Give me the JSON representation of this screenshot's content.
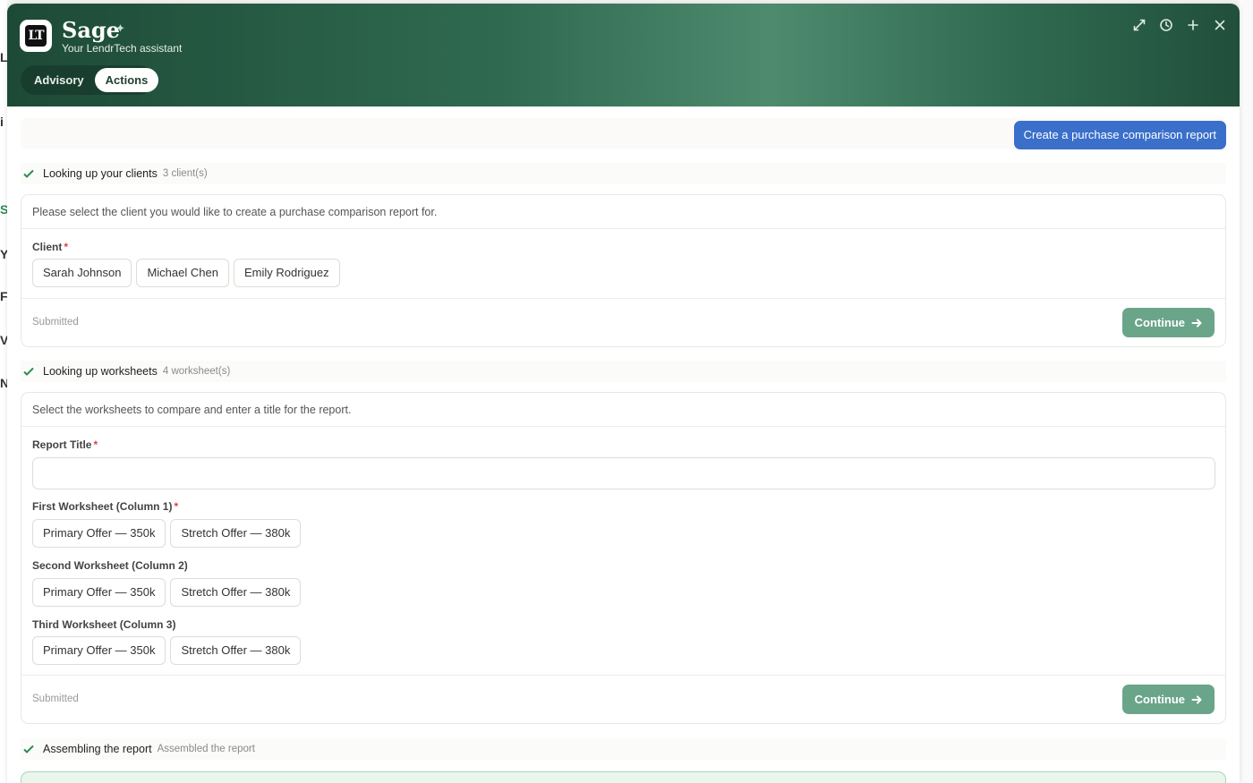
{
  "assistant": {
    "name": "Sage",
    "tagline": "Your LendrTech assistant",
    "logo_text": "LT"
  },
  "tabs": [
    {
      "label": "Advisory",
      "active": false
    },
    {
      "label": "Actions",
      "active": true
    }
  ],
  "header_icons": [
    "expand-icon",
    "history-icon",
    "plus-icon",
    "close-icon"
  ],
  "user_request": "Create a purchase comparison report",
  "steps": [
    {
      "label": "Looking up your clients",
      "detail": "3 client(s)"
    },
    {
      "label": "Looking up worksheets",
      "detail": "4 worksheet(s)"
    },
    {
      "label": "Assembling the report",
      "detail": "Assembled the report"
    }
  ],
  "client_card": {
    "prompt": "Please select the client you would like to create a purchase comparison report for.",
    "field_label": "Client",
    "options": [
      "Sarah Johnson",
      "Michael Chen",
      "Emily Rodriguez"
    ],
    "status": "Submitted",
    "continue_label": "Continue"
  },
  "worksheet_card": {
    "prompt": "Select the worksheets to compare and enter a title for the report.",
    "title_label": "Report Title",
    "title_value": "",
    "first_label": "First Worksheet (Column 1)",
    "second_label": "Second Worksheet (Column 2)",
    "third_label": "Third Worksheet (Column 3)",
    "options": [
      "Primary Offer — 350k",
      "Stretch Offer — 380k"
    ],
    "status": "Submitted",
    "continue_label": "Continue"
  },
  "colors": {
    "header_dark": "#1d4a37",
    "header_light": "#4e8a6e",
    "primary_button": "#3a6fca",
    "continue_button": "#6aa58a",
    "check": "#2f8a57",
    "required": "#dd4444"
  }
}
